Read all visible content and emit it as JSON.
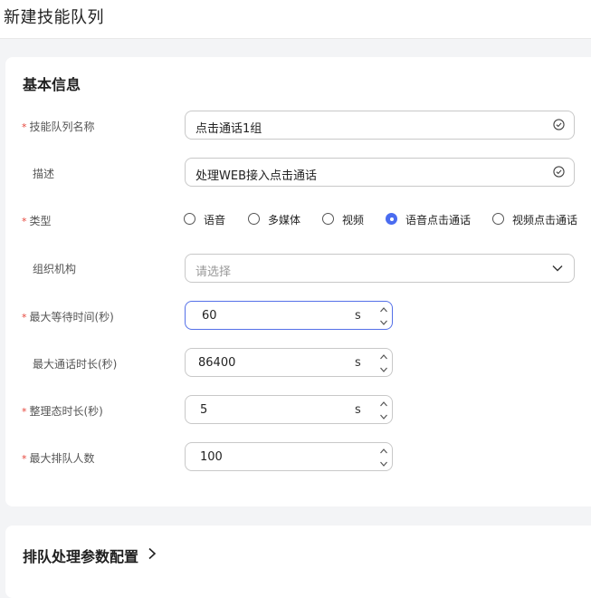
{
  "header": {
    "title": "新建技能队列"
  },
  "basic": {
    "section_title": "基本信息",
    "queue_name": {
      "label": "技能队列名称",
      "required": "*",
      "value": "点击通话1组"
    },
    "description": {
      "label": "描述",
      "value": "处理WEB接入点击通话"
    },
    "type": {
      "label": "类型",
      "required": "*",
      "options": [
        "语音",
        "多媒体",
        "视频",
        "语音点击通话",
        "视频点击通话"
      ],
      "selected": "语音点击通话"
    },
    "org": {
      "label": "组织机构",
      "placeholder": "请选择"
    },
    "max_wait": {
      "label": "最大等待时间(秒)",
      "required": "*",
      "value": "60",
      "unit": "s"
    },
    "max_call": {
      "label": "最大通话时长(秒)",
      "value": "86400",
      "unit": "s"
    },
    "wrapup": {
      "label": "整理态时长(秒)",
      "required": "*",
      "value": "5",
      "unit": "s"
    },
    "max_queue": {
      "label": "最大排队人数",
      "required": "*",
      "value": "100"
    }
  },
  "queue_config": {
    "section_title": "排队处理参数配置"
  },
  "icons": {
    "check": "check-circle-icon",
    "chevron": "chevron-down-icon",
    "stepper_up": "caret-up-icon",
    "stepper_down": "caret-down-icon",
    "expand": "chevron-right-icon"
  },
  "colors": {
    "accent": "#4a6cf0",
    "required": "#e6463c",
    "focus_border": "#5470e8"
  }
}
